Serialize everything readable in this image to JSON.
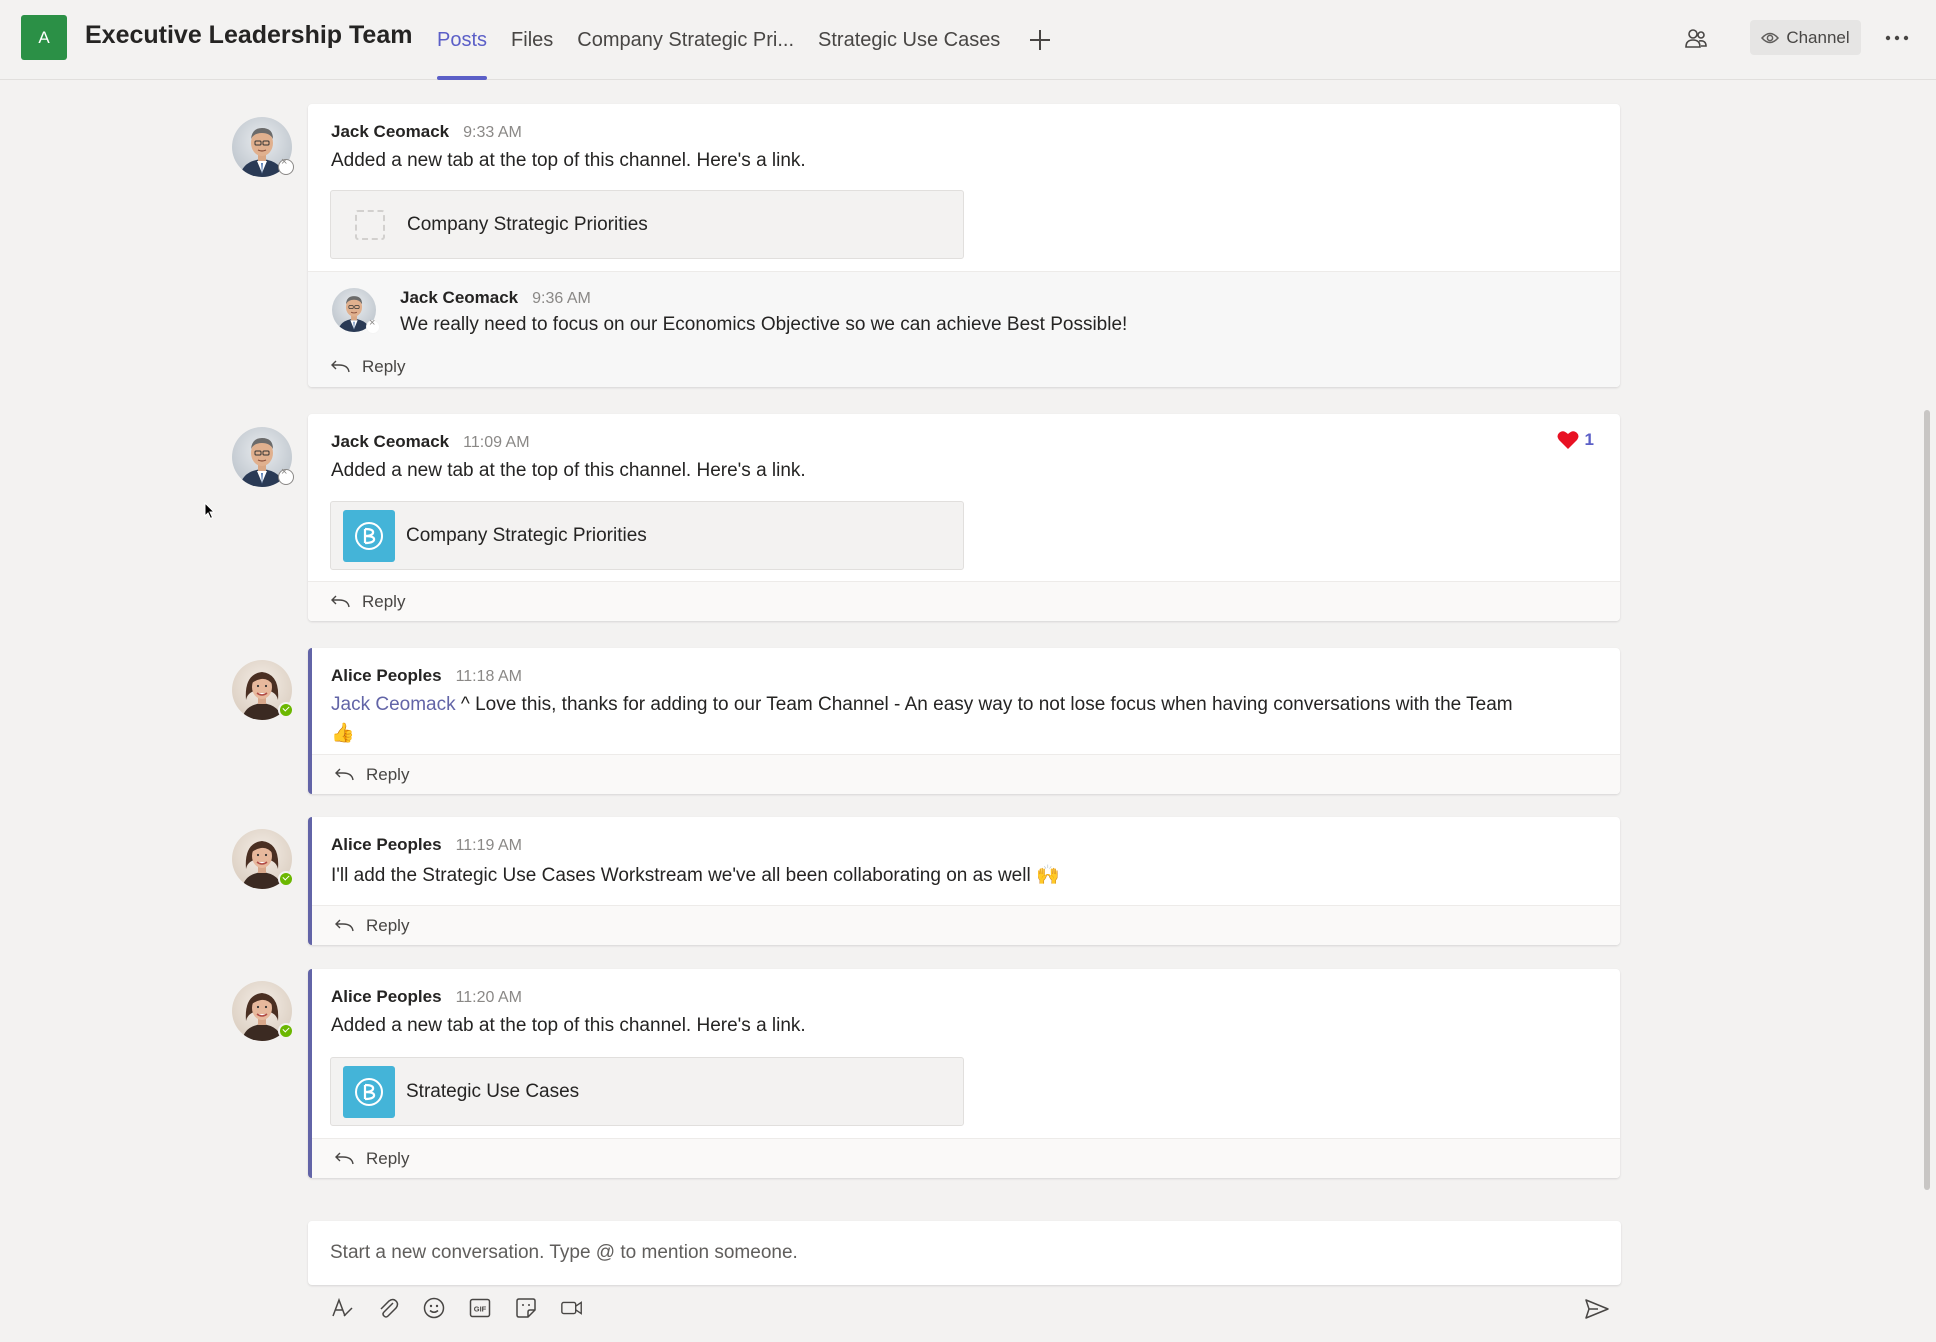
{
  "header": {
    "team_initial": "A",
    "team_name": "Executive Leadership Team",
    "tabs": [
      {
        "label": "Posts",
        "active": true
      },
      {
        "label": "Files",
        "active": false
      },
      {
        "label": "Company Strategic Pri...",
        "active": false
      },
      {
        "label": "Strategic Use Cases",
        "active": false
      }
    ],
    "channel_button": "Channel",
    "people_icon": "people-icon",
    "more_icon": "more-options-icon"
  },
  "colors": {
    "accent": "#6264a7",
    "team_tile": "#2b9046",
    "reaction_heart": "#e81123",
    "online": "#6bb700",
    "brand_icon": "#44b4d8"
  },
  "messages": [
    {
      "author": "Jack Ceomack",
      "time": "9:33 AM",
      "text": "Added a new tab at the top of this channel. Here's a link.",
      "link_card": "Company Strategic Priorities",
      "reply": {
        "author": "Jack Ceomack",
        "time": "9:36 AM",
        "text": "We really need to focus on our Economics Objective so we can achieve Best Possible!"
      },
      "reply_label": "Reply"
    },
    {
      "author": "Jack Ceomack",
      "time": "11:09 AM",
      "text": "Added a new tab at the top of this channel. Here's a link.",
      "link_card": "Company Strategic Priorities",
      "reaction": {
        "icon": "heart-icon",
        "count": "1"
      },
      "reply_label": "Reply"
    },
    {
      "author": "Alice Peoples",
      "time": "11:18 AM",
      "mention": "Jack Ceomack",
      "text": " ^ Love this, thanks for adding to our Team Channel - An easy way to not lose focus when having conversations with the Team",
      "emoji": "👍",
      "reply_label": "Reply"
    },
    {
      "author": "Alice Peoples",
      "time": "11:19 AM",
      "text": "I'll add the Strategic Use Cases Workstream we've all been collaborating on as well ",
      "emoji": "🙌",
      "reply_label": "Reply"
    },
    {
      "author": "Alice Peoples",
      "time": "11:20 AM",
      "text": "Added a new tab at the top of this channel. Here's a link.",
      "link_card": "Strategic Use Cases",
      "reply_label": "Reply"
    }
  ],
  "compose": {
    "placeholder": "Start a new conversation. Type @ to mention someone."
  },
  "toolbar": {
    "icons": [
      "format-icon",
      "attach-icon",
      "emoji-icon",
      "gif-icon",
      "sticker-icon",
      "meet-now-icon"
    ],
    "gif_label": "GIF",
    "send_icon": "send-icon"
  }
}
